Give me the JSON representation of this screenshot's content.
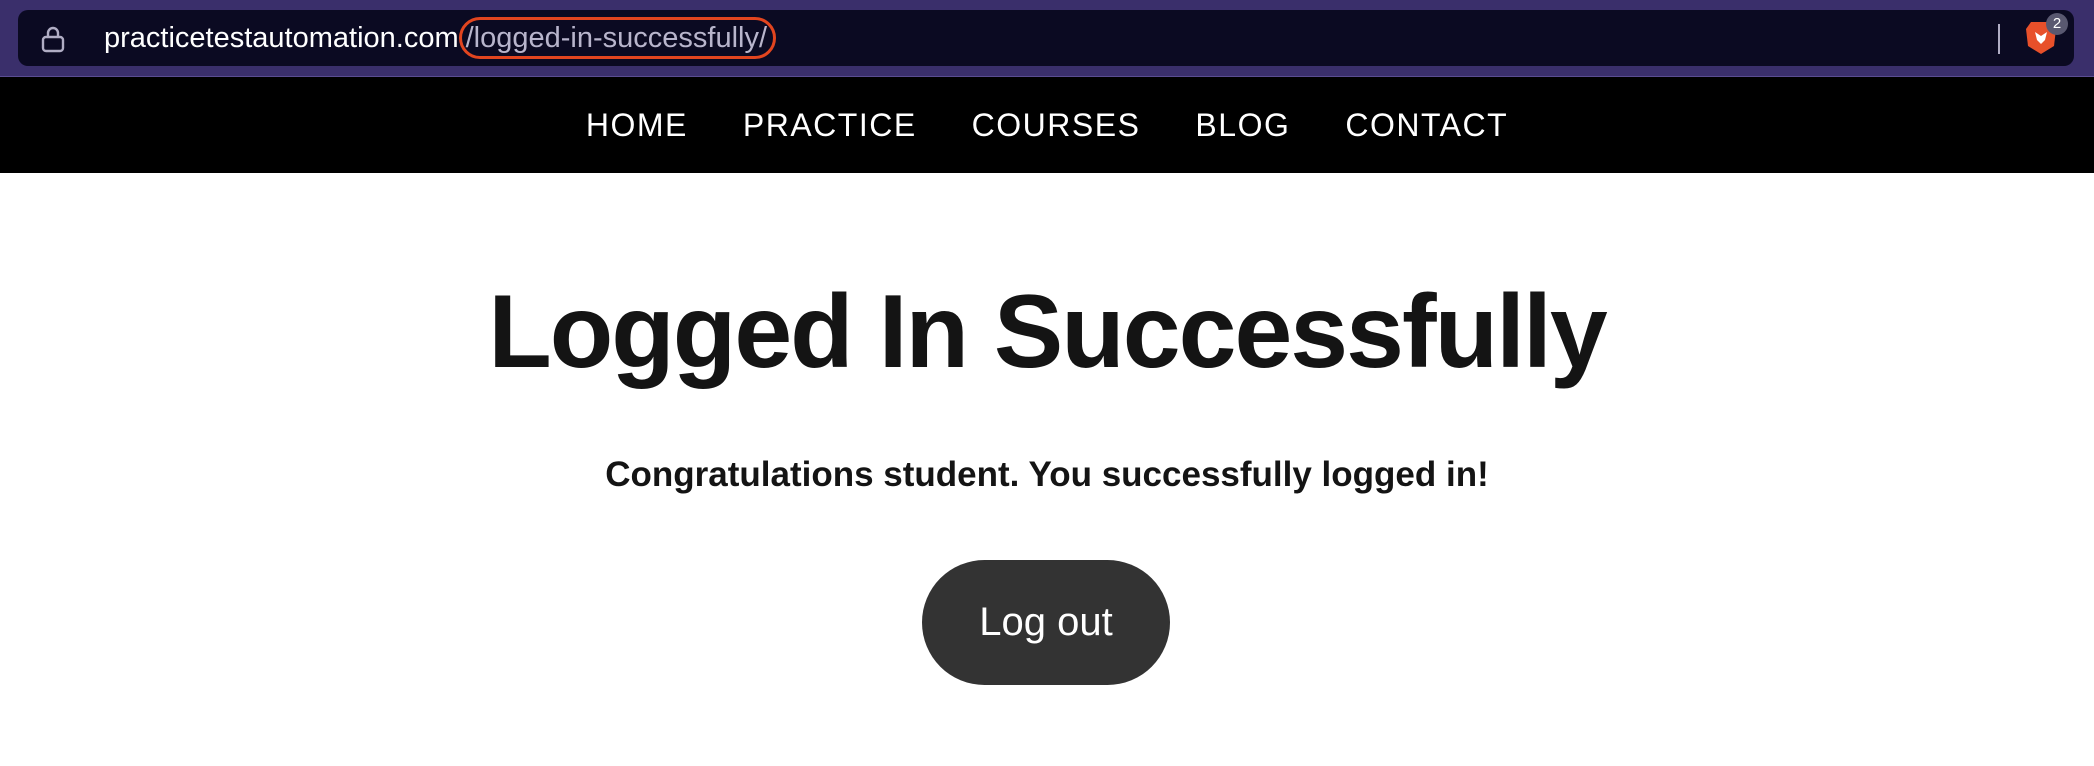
{
  "browser": {
    "url_domain": "practicetestautomation.com",
    "url_path": "/logged-in-successfully/",
    "shields_count": "2"
  },
  "nav": {
    "items": [
      {
        "label": "HOME"
      },
      {
        "label": "PRACTICE"
      },
      {
        "label": "COURSES"
      },
      {
        "label": "BLOG"
      },
      {
        "label": "CONTACT"
      }
    ]
  },
  "main": {
    "title": "Logged In Successfully",
    "message": "Congratulations student. You successfully logged in!",
    "logout_label": "Log out"
  },
  "colors": {
    "browser_chrome": "#3a2f6b",
    "url_field": "#0b0a22",
    "highlight_outline": "#e2451f",
    "nav_background": "#000000",
    "button_background": "#333333"
  },
  "icons": {
    "lock": "lock-icon",
    "brave": "brave-lion-icon"
  }
}
